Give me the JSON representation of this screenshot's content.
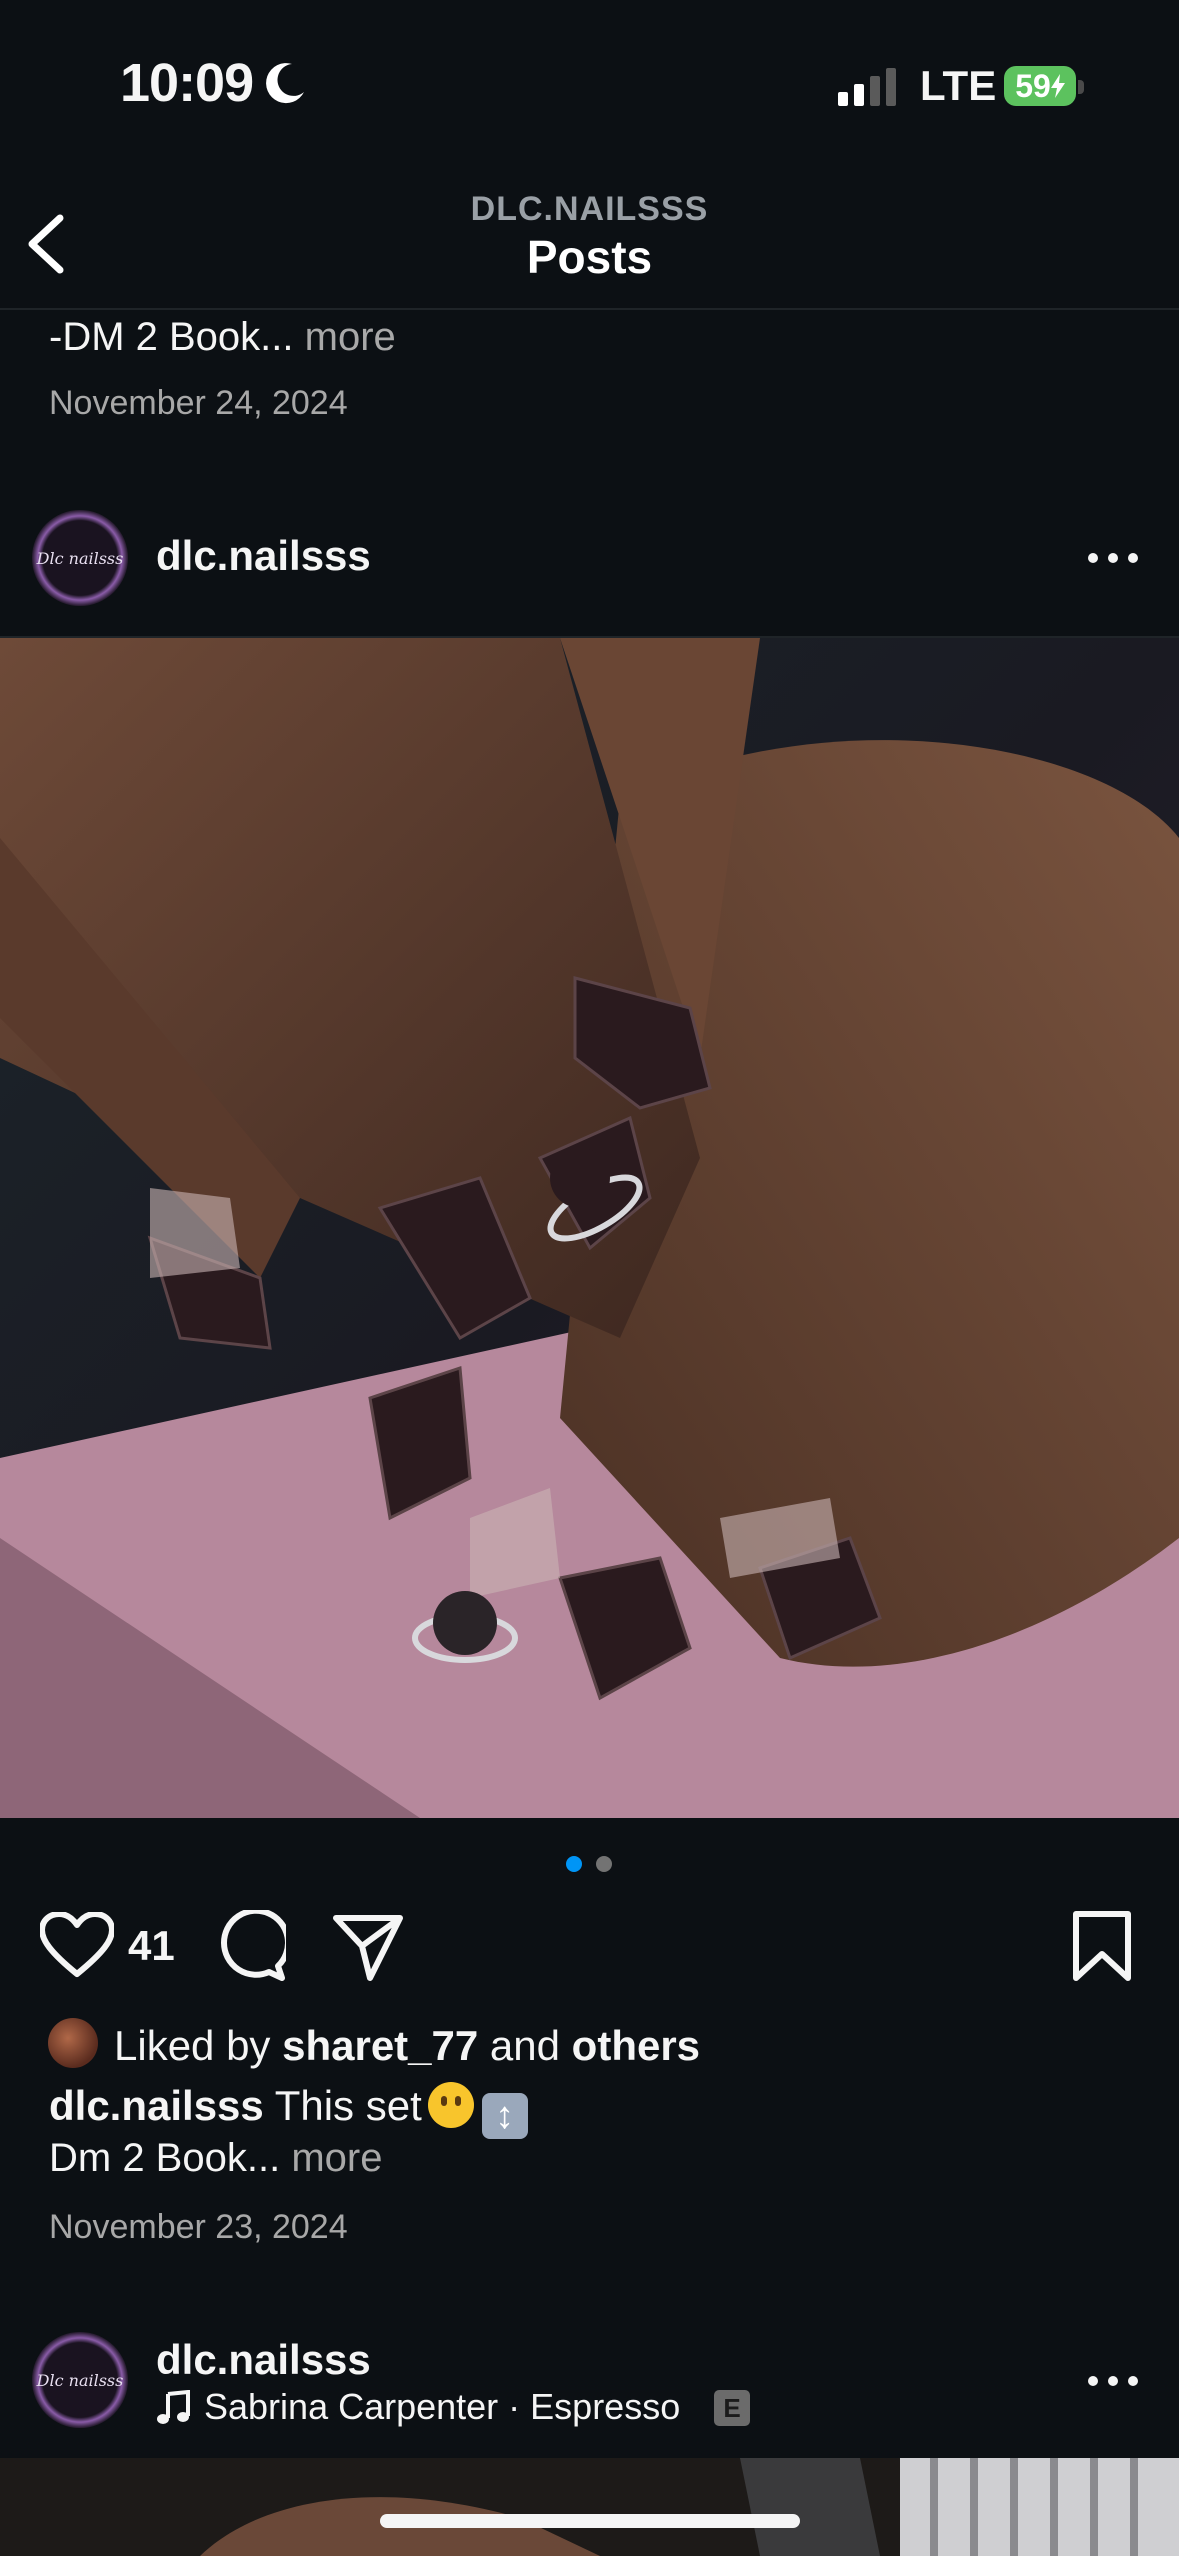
{
  "status_bar": {
    "time": "10:09",
    "network": "LTE",
    "battery": "59"
  },
  "header": {
    "username": "DLC.NAILSSS",
    "title": "Posts"
  },
  "previous_post": {
    "caption_text": "-DM 2 Book...",
    "more_label": "more",
    "date": "November 24, 2024"
  },
  "post": {
    "username": "dlc.nailsss",
    "avatar_text": "Dlc nailsss",
    "like_count": "41",
    "liked_by_prefix": "Liked by",
    "liked_by_user": "sharet_77",
    "liked_by_and": "and",
    "liked_by_others": "others",
    "caption_user": "dlc.nailsss",
    "caption_text": "This set",
    "caption_line2": "Dm 2 Book...",
    "more_label": "more",
    "date": "November 23, 2024",
    "carousel_total": 2,
    "carousel_active": 1
  },
  "next_post": {
    "username": "dlc.nailsss",
    "avatar_text": "Dlc nailsss",
    "music": "Sabrina Carpenter · Espresso",
    "explicit_badge": "E"
  },
  "colors": {
    "background": "#0c1014",
    "accent": "#0095f6",
    "muted": "#a8a8a8"
  }
}
